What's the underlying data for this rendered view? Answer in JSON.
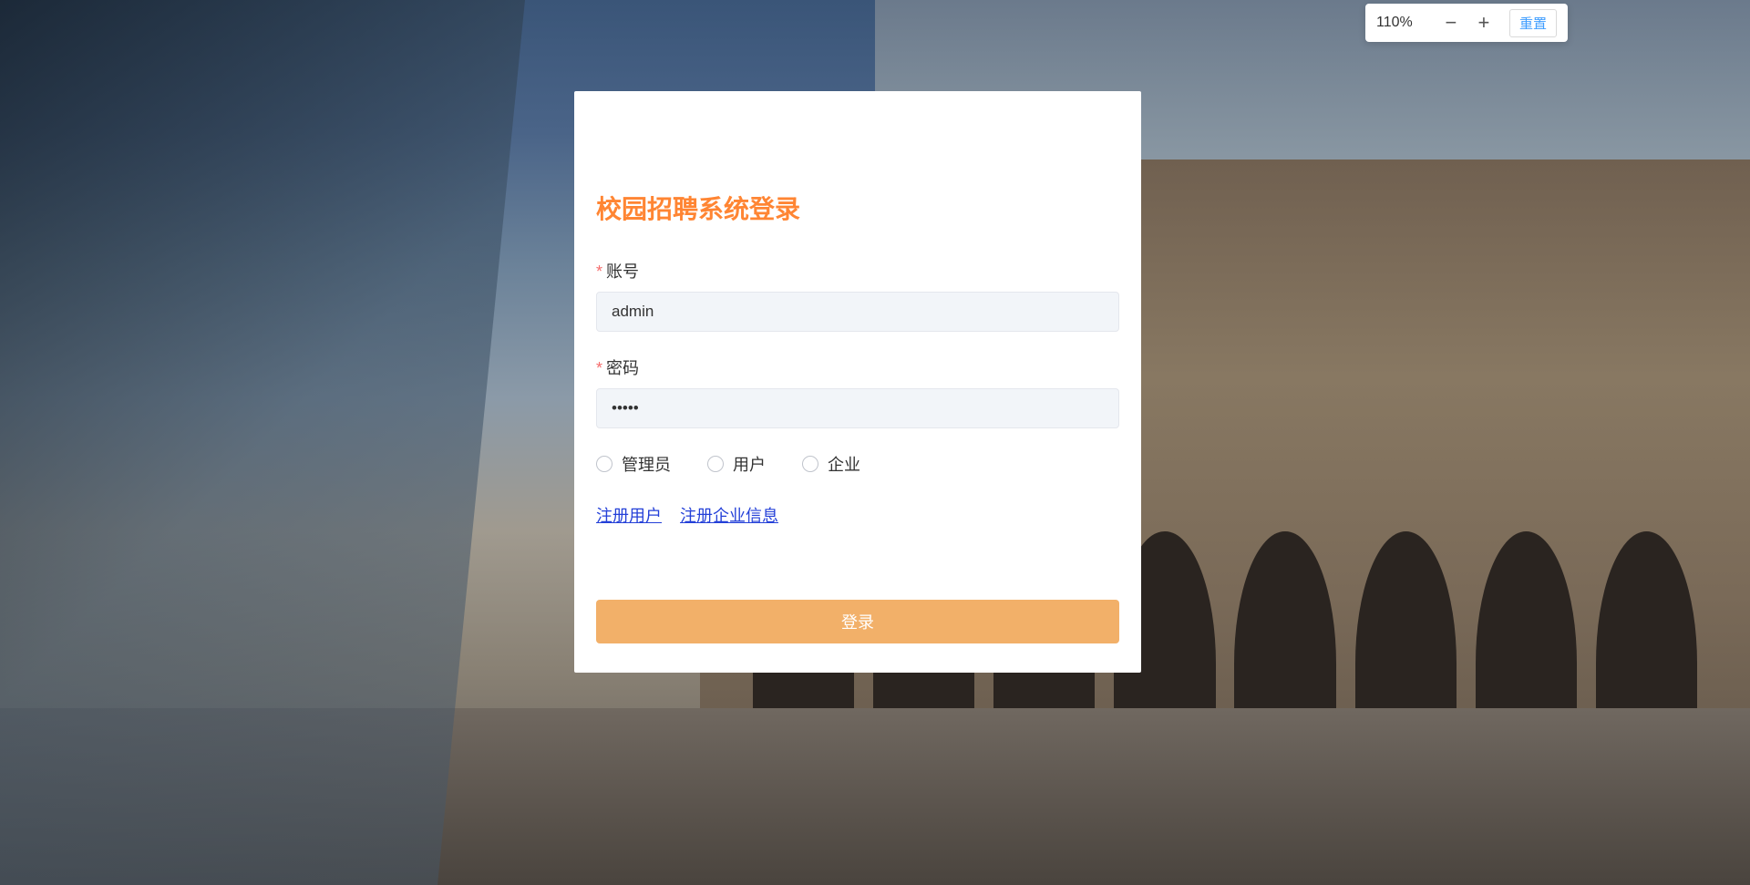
{
  "zoom": {
    "value": "110%",
    "reset": "重置"
  },
  "login": {
    "title": "校园招聘系统登录",
    "username_label": "账号",
    "username_value": "admin",
    "password_label": "密码",
    "password_value": "•••••",
    "roles": [
      {
        "label": "管理员"
      },
      {
        "label": "用户"
      },
      {
        "label": "企业"
      }
    ],
    "links": {
      "register_user": "注册用户",
      "register_company": "注册企业信息"
    },
    "submit": "登录"
  }
}
